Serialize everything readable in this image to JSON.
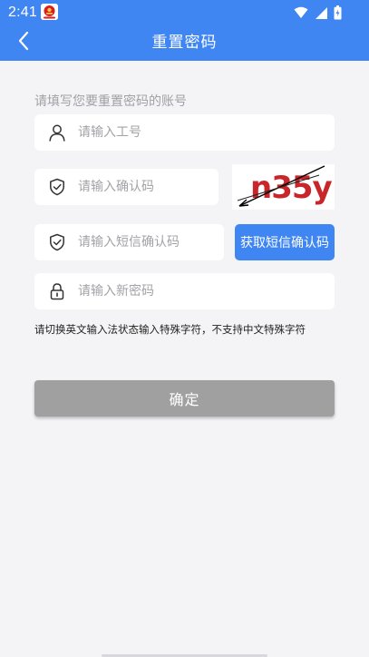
{
  "status_bar": {
    "time": "2:41",
    "app_icon": "china-emblem-app-icon",
    "icons": [
      "wifi-icon",
      "cellular-signal-icon",
      "battery-icon"
    ]
  },
  "header": {
    "title": "重置密码",
    "back_icon": "chevron-left-icon"
  },
  "form": {
    "section_label": "请填写您要重置密码的账号",
    "employee_id": {
      "value": "",
      "placeholder": "请输入工号",
      "icon": "user-icon"
    },
    "captcha": {
      "value": "",
      "placeholder": "请输入确认码",
      "icon": "shield-check-icon",
      "image_text": "n35y"
    },
    "sms_code": {
      "value": "",
      "placeholder": "请输入短信确认码",
      "icon": "shield-check-icon",
      "button_label": "获取短信确认码"
    },
    "new_password": {
      "value": "",
      "placeholder": "请输入新密码",
      "icon": "lock-icon"
    },
    "notice": "请切换英文输入法状态输入特殊字符，不支持中文特殊字符",
    "confirm_label": "确定"
  },
  "colors": {
    "primary": "#3f86f2",
    "background": "#f4f4f6",
    "disabled_button": "#a0a0a0",
    "captcha_text": "#c8262a"
  }
}
